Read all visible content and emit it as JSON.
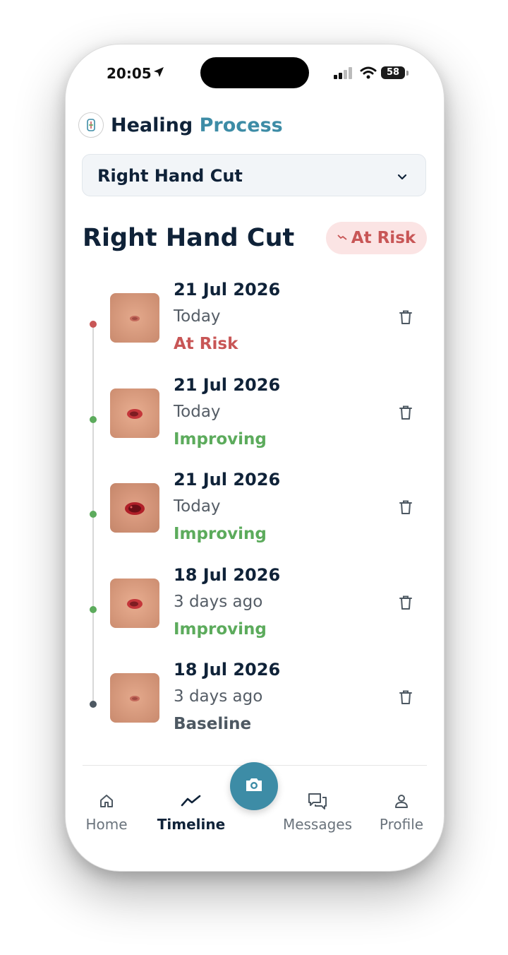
{
  "status_bar": {
    "time": "20:05",
    "battery": "58"
  },
  "header": {
    "title_part1": "Healing",
    "title_part2": "Process"
  },
  "wound_selector": {
    "selected": "Right Hand Cut"
  },
  "wound": {
    "title": "Right Hand Cut",
    "status_badge": "At Risk"
  },
  "entries": [
    {
      "date": "21 Jul 2026",
      "relative": "Today",
      "status": "At Risk",
      "status_color": "#c85656",
      "dot_color": "#c85656",
      "wound_severity": "mild"
    },
    {
      "date": "21 Jul 2026",
      "relative": "Today",
      "status": "Improving",
      "status_color": "#5cab5c",
      "dot_color": "#5cab5c",
      "wound_severity": "moderate"
    },
    {
      "date": "21 Jul 2026",
      "relative": "Today",
      "status": "Improving",
      "status_color": "#5cab5c",
      "dot_color": "#5cab5c",
      "wound_severity": "severe"
    },
    {
      "date": "18 Jul 2026",
      "relative": "3 days ago",
      "status": "Improving",
      "status_color": "#5cab5c",
      "dot_color": "#5cab5c",
      "wound_severity": "moderate"
    },
    {
      "date": "18 Jul 2026",
      "relative": "3 days ago",
      "status": "Baseline",
      "status_color": "#4d5862",
      "dot_color": "#4d5862",
      "wound_severity": "mild"
    }
  ],
  "nav": {
    "items": [
      {
        "label": "Home",
        "icon": "home-icon"
      },
      {
        "label": "Timeline",
        "icon": "trend-icon"
      },
      {
        "label": "Messages",
        "icon": "messages-icon"
      },
      {
        "label": "Profile",
        "icon": "profile-icon"
      }
    ],
    "center_action_icon": "camera-icon",
    "active": "Timeline"
  },
  "colors": {
    "brand_dark": "#0f2238",
    "brand_accent": "#3d8ca6",
    "at_risk": "#c85656",
    "improving": "#5cab5c",
    "baseline": "#4d5862"
  }
}
